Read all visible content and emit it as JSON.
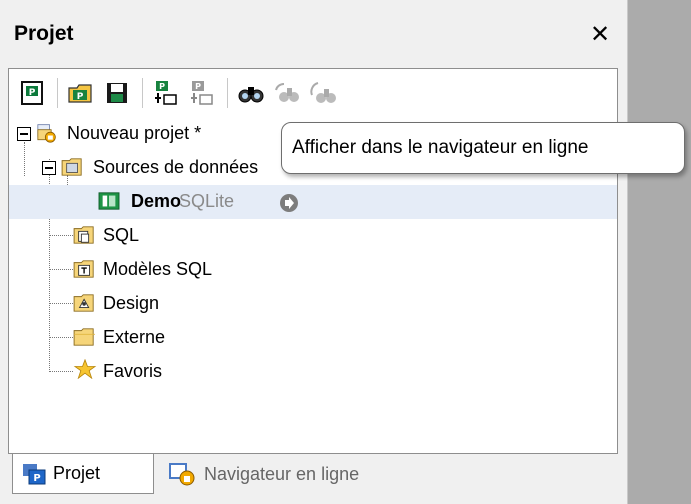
{
  "panel": {
    "title": "Projet",
    "close_label": "✕"
  },
  "toolbar": {
    "buttons": [
      "project-icon",
      "open-icon",
      "save-icon",
      "add-icon",
      "add-disabled-icon",
      "find-icon",
      "find-next-icon",
      "find-all-icon"
    ]
  },
  "tree": {
    "root": "Nouveau projet *",
    "sources": "Sources de données",
    "demo": "Demo",
    "demo_type": "SQLite",
    "sql": "SQL",
    "templates": "Modèles SQL",
    "design": "Design",
    "external": "Externe",
    "favorites": "Favoris"
  },
  "tooltip": {
    "text": "Afficher dans le navigateur en ligne"
  },
  "tabs": {
    "project": "Projet",
    "online_browser": "Navigateur en ligne"
  }
}
